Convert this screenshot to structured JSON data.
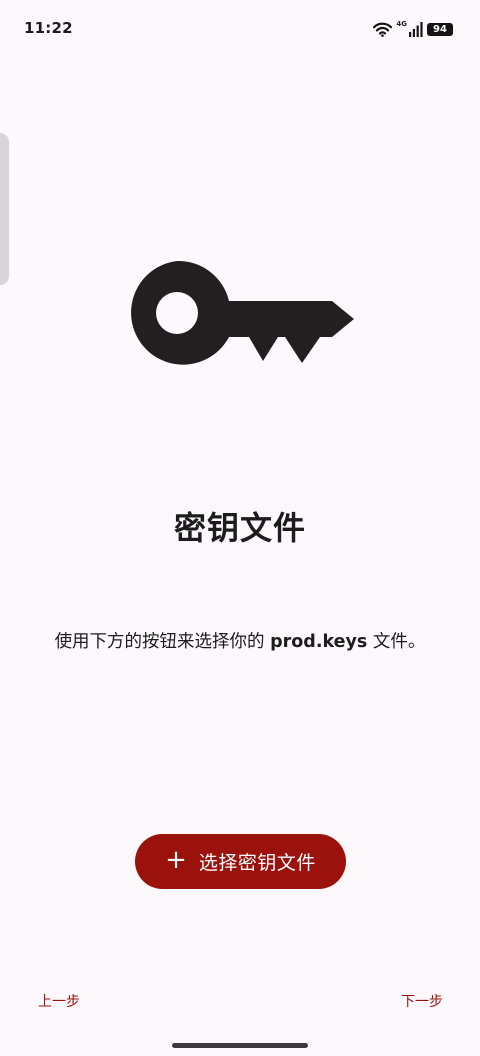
{
  "status_bar": {
    "time": "11:22",
    "network_type": "4G",
    "battery_level": "94",
    "icons": [
      "wifi-icon",
      "signal-icon",
      "battery-icon"
    ]
  },
  "hero": {
    "icon": "key-icon"
  },
  "page": {
    "title": "密钥文件",
    "instruction_before": "使用下方的按钮来选择你的 ",
    "instruction_bold": "prod.keys",
    "instruction_after": " 文件。"
  },
  "actions": {
    "select_button_icon": "plus-icon",
    "select_button_label": "选择密钥文件"
  },
  "navigation": {
    "prev_label": "上一步",
    "next_label": "下一步"
  },
  "colors": {
    "accent": "#9b110c",
    "background": "#fdf8fb",
    "text": "#1d1b1e",
    "icon": "#231f20"
  }
}
